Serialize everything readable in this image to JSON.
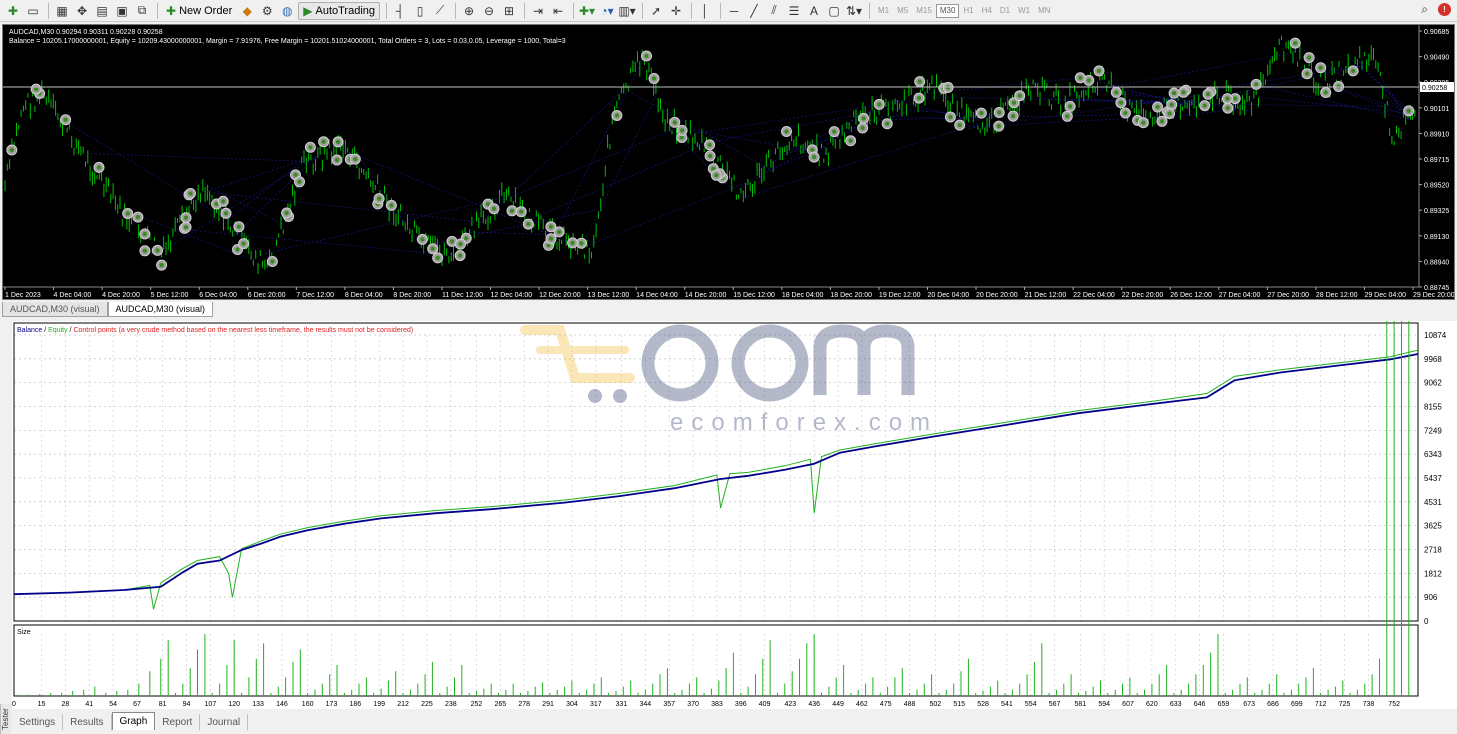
{
  "toolbar": {
    "new_order_label": "New Order",
    "autotrading_label": "AutoTrading",
    "timeframes": [
      "M1",
      "M5",
      "M15",
      "M30",
      "H1",
      "H4",
      "D1",
      "W1",
      "MN"
    ],
    "active_timeframe": "M30",
    "icons": [
      "new-chart-icon",
      "profiles-icon",
      "market-watch-icon",
      "navigator-icon",
      "data-window-icon",
      "terminal-icon",
      "strategy-tester-icon",
      "new-order-icon",
      "metaeditor-icon",
      "options-icon",
      "autotrading-icon",
      "bar-chart-icon",
      "candlestick-icon",
      "line-chart-icon",
      "zoom-in-icon",
      "zoom-out-icon",
      "tile-windows-icon",
      "autoscroll-icon",
      "chart-shift-icon",
      "indicators-icon",
      "periods-icon",
      "templates-icon",
      "cursor-icon",
      "crosshair-icon",
      "vertical-line-icon",
      "horizontal-line-icon",
      "trendline-icon",
      "equidistant-channel-icon",
      "fibonacci-icon",
      "text-icon",
      "text-label-icon",
      "arrows-icon"
    ],
    "colors": {
      "accent_red": "#d4312a"
    }
  },
  "chart": {
    "header_line1": "AUDCAD,M30  0.90294 0.90311 0.90228 0.90258",
    "header_line2": "Balance = 10205.17000000001, Equity = 10209.43000000001, Margin = 7.91976, Free Margin = 10201.51024000001, Total Orders = 3, Lots = 0.03,0.05, Leverage = 1000, Total=3",
    "current_price_label": "0.90258",
    "price_ticks": [
      "0.90685",
      "0.90490",
      "0.90295",
      "0.90101",
      "0.89910",
      "0.89715",
      "0.89520",
      "0.89325",
      "0.89130",
      "0.88940",
      "0.88745"
    ],
    "time_ticks": [
      "1 Dec 2023",
      "4 Dec 04:00",
      "4 Dec 20:00",
      "5 Dec 12:00",
      "6 Dec 04:00",
      "6 Dec 20:00",
      "7 Dec 12:00",
      "8 Dec 04:00",
      "8 Dec 20:00",
      "11 Dec 12:00",
      "12 Dec 04:00",
      "12 Dec 20:00",
      "13 Dec 12:00",
      "14 Dec 04:00",
      "14 Dec 20:00",
      "15 Dec 12:00",
      "18 Dec 04:00",
      "18 Dec 20:00",
      "19 Dec 12:00",
      "20 Dec 04:00",
      "20 Dec 20:00",
      "21 Dec 12:00",
      "22 Dec 04:00",
      "22 Dec 20:00",
      "26 Dec 12:00",
      "27 Dec 04:00",
      "27 Dec 20:00",
      "28 Dec 12:00",
      "29 Dec 04:00",
      "29 Dec 20:00"
    ],
    "colors": {
      "background": "#000000",
      "bar": "#00c000",
      "marker": "#a0a0a0",
      "lines": "#2020c0",
      "text": "#ffffff"
    }
  },
  "chart_tabs": [
    "AUDCAD,M30 (visual)",
    "AUDCAD,M30 (visual)"
  ],
  "active_chart_tab": 1,
  "watermark": {
    "text": "ecomforex.com"
  },
  "graph": {
    "legend_balance": "Balance",
    "legend_equity": "Equity",
    "legend_control": "Control points (a very crude method based on the nearest less timeframe, the results must not be considered)",
    "size_label": "Size",
    "colors": {
      "balance": "#00008b",
      "equity": "#1fb01f",
      "control": "#e02020",
      "size_bars": "#1fb01f"
    }
  },
  "chart_data": {
    "type": "line",
    "x_ticks": [
      "0",
      "15",
      "28",
      "41",
      "54",
      "67",
      "81",
      "94",
      "107",
      "120",
      "133",
      "146",
      "160",
      "173",
      "186",
      "199",
      "212",
      "225",
      "238",
      "252",
      "265",
      "278",
      "291",
      "304",
      "317",
      "331",
      "344",
      "357",
      "370",
      "383",
      "396",
      "409",
      "423",
      "436",
      "449",
      "462",
      "475",
      "488",
      "502",
      "515",
      "528",
      "541",
      "554",
      "567",
      "581",
      "594",
      "607",
      "620",
      "633",
      "646",
      "659",
      "673",
      "686",
      "699",
      "712",
      "725",
      "738",
      "752"
    ],
    "y_ticks": [
      "10874",
      "9968",
      "9062",
      "8155",
      "7249",
      "6343",
      "5437",
      "4531",
      "3625",
      "2718",
      "1812",
      "906",
      "0"
    ],
    "xlim": [
      0,
      765
    ],
    "ylim": [
      0,
      10874
    ],
    "series": [
      {
        "name": "Balance",
        "x": [
          0,
          30,
          60,
          80,
          92,
          100,
          112,
          124,
          135,
          145,
          160,
          180,
          200,
          230,
          260,
          300,
          330,
          360,
          385,
          400,
          420,
          436,
          450,
          470,
          500,
          540,
          580,
          620,
          650,
          665,
          690,
          720,
          750,
          765
        ],
        "y": [
          1020,
          1080,
          1180,
          1300,
          1850,
          2180,
          2300,
          2700,
          2950,
          3200,
          3450,
          3700,
          3900,
          4100,
          4250,
          4500,
          4750,
          5050,
          5400,
          5520,
          5750,
          5980,
          6400,
          6650,
          7000,
          7450,
          7900,
          8250,
          8500,
          9150,
          9450,
          9700,
          9950,
          10150
        ]
      },
      {
        "name": "Equity",
        "x": [
          0,
          30,
          60,
          74,
          76,
          80,
          92,
          100,
          112,
          117,
          119,
          124,
          135,
          145,
          160,
          180,
          200,
          230,
          260,
          300,
          330,
          360,
          383,
          385,
          390,
          400,
          420,
          434,
          436,
          440,
          450,
          470,
          500,
          540,
          580,
          620,
          650,
          665,
          690,
          720,
          750,
          765
        ],
        "y": [
          1020,
          1080,
          1180,
          1350,
          450,
          1450,
          2000,
          2300,
          2450,
          1800,
          900,
          2750,
          3050,
          3300,
          3550,
          3800,
          4000,
          4200,
          4350,
          4600,
          4850,
          5150,
          5550,
          4300,
          5600,
          5650,
          5900,
          6150,
          4100,
          6250,
          6500,
          6750,
          7100,
          7550,
          8000,
          8350,
          8650,
          9300,
          9550,
          9800,
          10050,
          10300
        ]
      }
    ],
    "size_series": {
      "name": "Size",
      "x": [
        2,
        8,
        14,
        20,
        26,
        32,
        38,
        44,
        50,
        56,
        62,
        68,
        74,
        80,
        84,
        88,
        92,
        96,
        100,
        104,
        108,
        112,
        116,
        120,
        124,
        128,
        132,
        136,
        140,
        144,
        148,
        152,
        156,
        160,
        164,
        168,
        172,
        176,
        180,
        184,
        188,
        192,
        196,
        200,
        204,
        208,
        212,
        216,
        220,
        224,
        228,
        232,
        236,
        240,
        244,
        248,
        252,
        256,
        260,
        264,
        268,
        272,
        276,
        280,
        284,
        288,
        292,
        296,
        300,
        304,
        308,
        312,
        316,
        320,
        324,
        328,
        332,
        336,
        340,
        344,
        348,
        352,
        356,
        360,
        364,
        368,
        372,
        376,
        380,
        384,
        388,
        392,
        396,
        400,
        404,
        408,
        412,
        416,
        420,
        424,
        428,
        432,
        436,
        440,
        444,
        448,
        452,
        456,
        460,
        464,
        468,
        472,
        476,
        480,
        484,
        488,
        492,
        496,
        500,
        504,
        508,
        512,
        516,
        520,
        524,
        528,
        532,
        536,
        540,
        544,
        548,
        552,
        556,
        560,
        564,
        568,
        572,
        576,
        580,
        584,
        588,
        592,
        596,
        600,
        604,
        608,
        612,
        616,
        620,
        624,
        628,
        632,
        636,
        640,
        644,
        648,
        652,
        656,
        660,
        664,
        668,
        672,
        676,
        680,
        684,
        688,
        692,
        696,
        700,
        704,
        708,
        712,
        716,
        720,
        724,
        728,
        732,
        736,
        740,
        744,
        748,
        752,
        756,
        760
      ],
      "y": [
        0.02,
        0.02,
        0.03,
        0.05,
        0.05,
        0.08,
        0.1,
        0.15,
        0.05,
        0.08,
        0.1,
        0.2,
        0.4,
        0.6,
        0.9,
        0.05,
        0.2,
        0.45,
        0.75,
        1.0,
        0.05,
        0.2,
        0.5,
        0.9,
        0.05,
        0.3,
        0.6,
        0.85,
        0.05,
        0.15,
        0.3,
        0.55,
        0.75,
        0.05,
        0.1,
        0.2,
        0.35,
        0.5,
        0.05,
        0.1,
        0.2,
        0.3,
        0.05,
        0.12,
        0.25,
        0.4,
        0.05,
        0.1,
        0.2,
        0.35,
        0.55,
        0.05,
        0.15,
        0.3,
        0.5,
        0.05,
        0.08,
        0.12,
        0.2,
        0.05,
        0.1,
        0.2,
        0.05,
        0.08,
        0.15,
        0.22,
        0.05,
        0.1,
        0.15,
        0.25,
        0.05,
        0.1,
        0.2,
        0.3,
        0.05,
        0.08,
        0.15,
        0.25,
        0.05,
        0.1,
        0.2,
        0.35,
        0.45,
        0.05,
        0.1,
        0.2,
        0.3,
        0.05,
        0.12,
        0.25,
        0.45,
        0.7,
        0.05,
        0.15,
        0.35,
        0.6,
        0.9,
        0.05,
        0.2,
        0.4,
        0.6,
        0.85,
        1.0,
        0.05,
        0.15,
        0.3,
        0.5,
        0.05,
        0.1,
        0.2,
        0.3,
        0.05,
        0.15,
        0.3,
        0.45,
        0.05,
        0.1,
        0.2,
        0.35,
        0.05,
        0.1,
        0.2,
        0.4,
        0.6,
        0.05,
        0.08,
        0.15,
        0.25,
        0.05,
        0.1,
        0.2,
        0.35,
        0.55,
        0.85,
        0.05,
        0.1,
        0.2,
        0.35,
        0.05,
        0.08,
        0.15,
        0.25,
        0.05,
        0.1,
        0.2,
        0.3,
        0.05,
        0.1,
        0.2,
        0.35,
        0.5,
        0.05,
        0.1,
        0.2,
        0.35,
        0.5,
        0.7,
        1.0,
        0.05,
        0.1,
        0.2,
        0.3,
        0.05,
        0.1,
        0.2,
        0.35,
        0.05,
        0.1,
        0.2,
        0.3,
        0.45,
        0.05,
        0.1,
        0.15,
        0.25,
        0.05,
        0.1,
        0.2,
        0.35,
        0.6
      ]
    },
    "ylabel": "",
    "grid": true
  },
  "bottom_tabs": [
    "Settings",
    "Results",
    "Graph",
    "Report",
    "Journal"
  ],
  "active_bottom_tab": 2,
  "side_label": "Tester"
}
